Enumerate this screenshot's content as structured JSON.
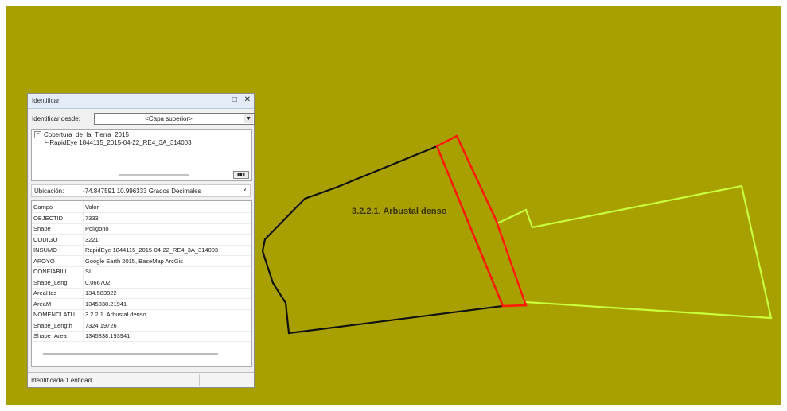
{
  "map": {
    "background": "#a8a000",
    "polygon_label": "3.2.2.1. Arbustal denso"
  },
  "identify": {
    "title": "Identificar",
    "controls": {
      "dock_icon": "dock-icon",
      "close_icon": "close-icon"
    },
    "from_label": "Identificar desde:",
    "from_value": "<Capa superior>",
    "tree": {
      "layer": "Cobertura_de_la_Tierra_2015",
      "feature": "RapidEye 1844115_2015-04-22_RE4_3A_314003"
    },
    "location_label": "Ubicación:",
    "location_value": "-74.847591  10.996333 Grados Decimales",
    "attributes": {
      "headers": [
        "Campo",
        "Valor"
      ],
      "rows": [
        [
          "OBJECTID",
          "7333"
        ],
        [
          "Shape",
          "Polígono"
        ],
        [
          "CODIGO",
          "3221"
        ],
        [
          "INSUMO",
          "RapidEye 1844115_2015-04-22_RE4_3A_314003"
        ],
        [
          "APOYO",
          "Google Earth 2015, BaseMap ArcGis"
        ],
        [
          "CONFIABILI",
          "SI"
        ],
        [
          "Shape_Leng",
          "0.066702"
        ],
        [
          "AreaHas",
          "134.583822"
        ],
        [
          "AreaM",
          "1345838.21941"
        ],
        [
          "NOMENCLATU",
          "3.2.2.1. Arbustal denso"
        ],
        [
          "Shape_Length",
          "7324.19726"
        ],
        [
          "Shape_Area",
          "1345838.193941"
        ]
      ]
    },
    "status": "Identificada 1 entidad"
  },
  "colors": {
    "map_bg": "#a8a000",
    "polygon_black": "#111111",
    "polygon_red": "#ff1a00",
    "polygon_green": "#c8ff3a"
  }
}
